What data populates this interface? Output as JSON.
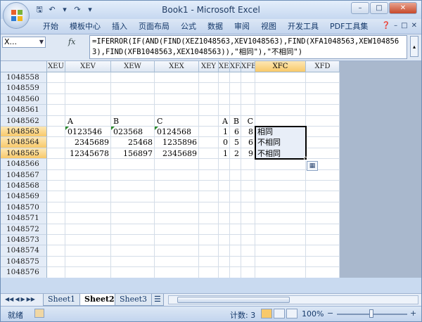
{
  "window": {
    "title": "Book1 - Microsoft Excel"
  },
  "ribbon": {
    "tabs": [
      "开始",
      "模板中心",
      "插入",
      "页面布局",
      "公式",
      "数据",
      "审阅",
      "视图",
      "开发工具",
      "PDF工具集"
    ]
  },
  "formula_bar": {
    "name_box": "X...",
    "fx_label": "fx",
    "formula": "=IFERROR(IF(AND(FIND(XEZ1048563,XEV1048563),FIND(XFA1048563,XEW1048563),FIND(XFB1048563,XEX1048563)),\"相同\"),\"不相同\")"
  },
  "columns": [
    {
      "label": "XEU",
      "selected": false
    },
    {
      "label": "XEV",
      "selected": false
    },
    {
      "label": "XEW",
      "selected": false
    },
    {
      "label": "XEX",
      "selected": false
    },
    {
      "label": "XEY",
      "selected": false
    },
    {
      "label": "XEZ",
      "selected": false
    },
    {
      "label": "XFA",
      "selected": false
    },
    {
      "label": "XFB",
      "selected": false
    },
    {
      "label": "XFC",
      "selected": true
    },
    {
      "label": "XFD",
      "selected": false
    }
  ],
  "rows": [
    {
      "label": "1048558",
      "selected": false
    },
    {
      "label": "1048559",
      "selected": false
    },
    {
      "label": "1048560",
      "selected": false
    },
    {
      "label": "1048561",
      "selected": false
    },
    {
      "label": "1048562",
      "selected": false
    },
    {
      "label": "1048563",
      "selected": true
    },
    {
      "label": "1048564",
      "selected": true
    },
    {
      "label": "1048565",
      "selected": true
    },
    {
      "label": "1048566",
      "selected": false
    },
    {
      "label": "1048567",
      "selected": false
    },
    {
      "label": "1048568",
      "selected": false
    },
    {
      "label": "1048569",
      "selected": false
    },
    {
      "label": "1048570",
      "selected": false
    },
    {
      "label": "1048571",
      "selected": false
    },
    {
      "label": "1048572",
      "selected": false
    },
    {
      "label": "1048573",
      "selected": false
    },
    {
      "label": "1048574",
      "selected": false
    },
    {
      "label": "1048575",
      "selected": false
    },
    {
      "label": "1048576",
      "selected": false
    }
  ],
  "cells": [
    {
      "row": 4,
      "col": 1,
      "value": "A",
      "align": "l",
      "tri": false
    },
    {
      "row": 4,
      "col": 2,
      "value": "B",
      "align": "l",
      "tri": false
    },
    {
      "row": 4,
      "col": 3,
      "value": "C",
      "align": "l",
      "tri": false
    },
    {
      "row": 4,
      "col": 5,
      "value": "A",
      "align": "r",
      "tri": false
    },
    {
      "row": 4,
      "col": 6,
      "value": "B",
      "align": "r",
      "tri": false
    },
    {
      "row": 4,
      "col": 7,
      "value": "C",
      "align": "r",
      "tri": false
    },
    {
      "row": 5,
      "col": 1,
      "value": "0123546",
      "align": "l",
      "tri": true
    },
    {
      "row": 5,
      "col": 2,
      "value": "023568",
      "align": "l",
      "tri": true
    },
    {
      "row": 5,
      "col": 3,
      "value": "0124568",
      "align": "l",
      "tri": true
    },
    {
      "row": 5,
      "col": 5,
      "value": "1",
      "align": "r",
      "tri": false
    },
    {
      "row": 5,
      "col": 6,
      "value": "6",
      "align": "r",
      "tri": false
    },
    {
      "row": 5,
      "col": 7,
      "value": "8",
      "align": "r",
      "tri": false
    },
    {
      "row": 5,
      "col": 8,
      "value": "相同",
      "align": "l",
      "tri": false
    },
    {
      "row": 6,
      "col": 1,
      "value": "2345689",
      "align": "r",
      "tri": false
    },
    {
      "row": 6,
      "col": 2,
      "value": "25468",
      "align": "r",
      "tri": false
    },
    {
      "row": 6,
      "col": 3,
      "value": "1235896",
      "align": "r",
      "tri": false
    },
    {
      "row": 6,
      "col": 5,
      "value": "0",
      "align": "r",
      "tri": false
    },
    {
      "row": 6,
      "col": 6,
      "value": "5",
      "align": "r",
      "tri": false
    },
    {
      "row": 6,
      "col": 7,
      "value": "6",
      "align": "r",
      "tri": false
    },
    {
      "row": 6,
      "col": 8,
      "value": "不相同",
      "align": "l",
      "tri": false
    },
    {
      "row": 7,
      "col": 1,
      "value": "12345678",
      "align": "r",
      "tri": false
    },
    {
      "row": 7,
      "col": 2,
      "value": "156897",
      "align": "r",
      "tri": false
    },
    {
      "row": 7,
      "col": 3,
      "value": "2345689",
      "align": "r",
      "tri": false
    },
    {
      "row": 7,
      "col": 5,
      "value": "1",
      "align": "r",
      "tri": false
    },
    {
      "row": 7,
      "col": 6,
      "value": "2",
      "align": "r",
      "tri": false
    },
    {
      "row": 7,
      "col": 7,
      "value": "9",
      "align": "r",
      "tri": false
    },
    {
      "row": 7,
      "col": 8,
      "value": "不相同",
      "align": "l",
      "tri": false
    }
  ],
  "sheet_tabs": [
    {
      "label": "Sheet1",
      "active": false
    },
    {
      "label": "Sheet2",
      "active": true
    },
    {
      "label": "Sheet3",
      "active": false
    }
  ],
  "status": {
    "ready": "就绪",
    "count": "计数: 3",
    "zoom": "100%",
    "zoom_minus": "−",
    "zoom_plus": "+"
  },
  "icons": {
    "save": "save-icon",
    "undo": "undo-icon",
    "redo": "redo-icon",
    "paste_options": "paste-options-icon",
    "office": "office-logo-icon",
    "insert_sheet": "insert-sheet-icon"
  }
}
